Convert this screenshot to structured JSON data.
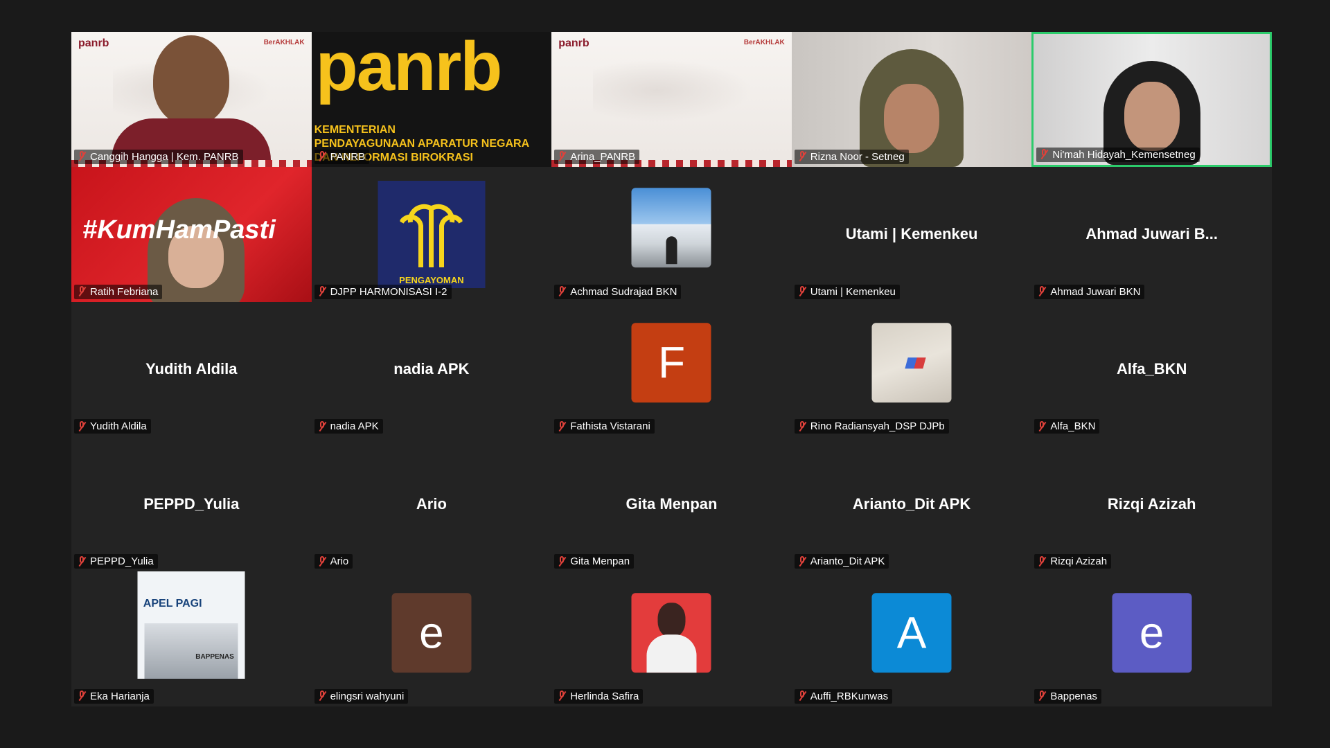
{
  "tiles": [
    {
      "label": "Canggih Hangga | Kem. PANRB",
      "type": "video-banner",
      "brand_left": "panrb",
      "brand_right": "BerAKHLAK"
    },
    {
      "label": "PANRB",
      "type": "panrb-logo",
      "logo": "panrb",
      "subtitle": "KEMENTERIAN\nPENDAYAGUNAAN APARATUR NEGARA\nDAN REFORMASI BIROKRASI"
    },
    {
      "label": "Arina_PANRB",
      "type": "video-banner-empty",
      "brand_left": "panrb",
      "brand_right": "BerAKHLAK"
    },
    {
      "label": "Rizna Noor - Setneg",
      "type": "video-camera"
    },
    {
      "label": "Ni'mah Hidayah_Kemensetneg",
      "type": "video-camera-headset",
      "active": true
    },
    {
      "label": "Ratih Febriana",
      "type": "video-red",
      "tag": "#KumHamPasti"
    },
    {
      "label": "DJPP HARMONISASI I-2",
      "type": "logo",
      "logo_text": "PENGAYOMAN"
    },
    {
      "label": "Achmad Sudrajad BKN",
      "type": "photo-building"
    },
    {
      "label": "Utami | Kemenkeu",
      "type": "name",
      "display_name": "Utami | Kemenkeu"
    },
    {
      "label": "Ahmad Juwari BKN",
      "type": "name",
      "display_name": "Ahmad Juwari B..."
    },
    {
      "label": "Yudith Aldila",
      "type": "name",
      "display_name": "Yudith Aldila"
    },
    {
      "label": "nadia APK",
      "type": "name",
      "display_name": "nadia APK"
    },
    {
      "label": "Fathista Vistarani",
      "type": "letter",
      "letter": "F",
      "color": "#c43e12"
    },
    {
      "label": "Rino Radiansyah_DSP DJPb",
      "type": "photo-floor"
    },
    {
      "label": "Alfa_BKN",
      "type": "name",
      "display_name": "Alfa_BKN"
    },
    {
      "label": "PEPPD_Yulia",
      "type": "name",
      "display_name": "PEPPD_Yulia"
    },
    {
      "label": "Ario",
      "type": "name",
      "display_name": "Ario"
    },
    {
      "label": "Gita Menpan",
      "type": "name",
      "display_name": "Gita Menpan"
    },
    {
      "label": "Arianto_Dit APK",
      "type": "name",
      "display_name": "Arianto_Dit APK"
    },
    {
      "label": "Rizqi Azizah",
      "type": "name",
      "display_name": "Rizqi Azizah"
    },
    {
      "label": "Eka Harianja",
      "type": "poster",
      "poster_title": "APEL PAGI",
      "poster_footer": "BAPPENAS"
    },
    {
      "label": "elingsri wahyuni",
      "type": "letter",
      "letter": "e",
      "color": "#5f3a2c"
    },
    {
      "label": "Herlinda Safira",
      "type": "photo-portrait"
    },
    {
      "label": "Auffi_RBKunwas",
      "type": "letter",
      "letter": "A",
      "color": "#0c8ad6"
    },
    {
      "label": "Bappenas",
      "type": "letter",
      "letter": "e",
      "color": "#5c5cc4"
    }
  ],
  "icons": {
    "muted": "mic-muted-icon"
  },
  "colors": {
    "active_speaker": "#2ccb6b",
    "muted": "#e0413a",
    "tile_bg": "#232323"
  }
}
